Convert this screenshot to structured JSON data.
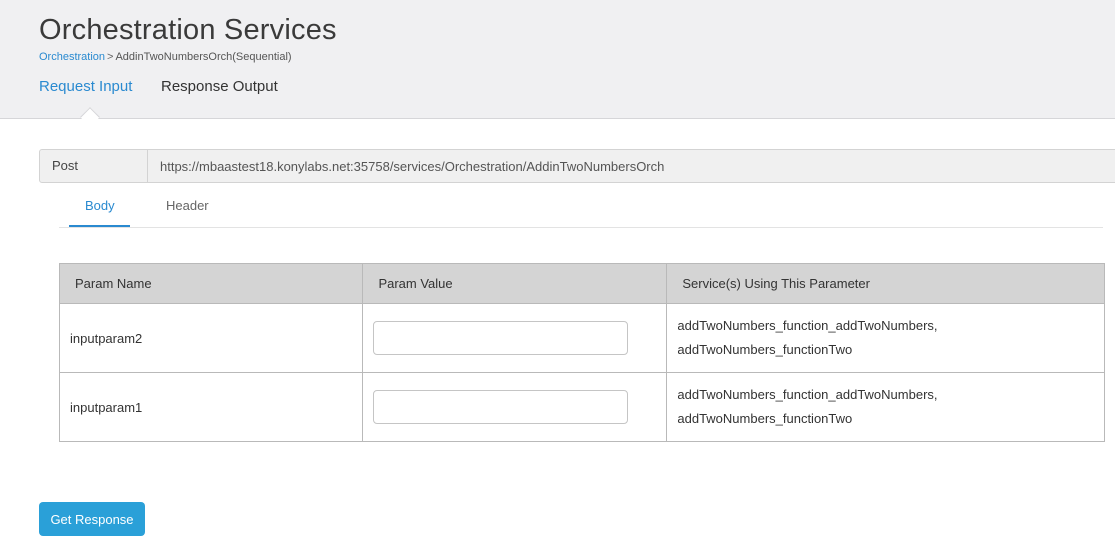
{
  "header": {
    "title": "Orchestration Services",
    "breadcrumb": {
      "link": "Orchestration",
      "separator": ">",
      "current": "AddinTwoNumbersOrch(Sequential)"
    },
    "tabs": [
      {
        "label": "Request Input",
        "active": true
      },
      {
        "label": "Response Output",
        "active": false
      }
    ]
  },
  "request": {
    "method": "Post",
    "url": "https://mbaastest18.konylabs.net:35758/services/Orchestration/AddinTwoNumbersOrch"
  },
  "subtabs": [
    {
      "label": "Body",
      "active": true
    },
    {
      "label": "Header",
      "active": false
    }
  ],
  "table": {
    "columns": [
      "Param Name",
      "Param Value",
      "Service(s) Using This Parameter"
    ],
    "rows": [
      {
        "name": "inputparam2",
        "value": "",
        "services": [
          "addTwoNumbers_function_addTwoNumbers,",
          "addTwoNumbers_functionTwo"
        ]
      },
      {
        "name": "inputparam1",
        "value": "",
        "services": [
          "addTwoNumbers_function_addTwoNumbers,",
          "addTwoNumbers_functionTwo"
        ]
      }
    ]
  },
  "actions": {
    "get_response_label": "Get Response"
  },
  "colors": {
    "accent": "#2a8ad0",
    "button": "#2aa0d8",
    "header_bg": "#f0f0f2"
  }
}
